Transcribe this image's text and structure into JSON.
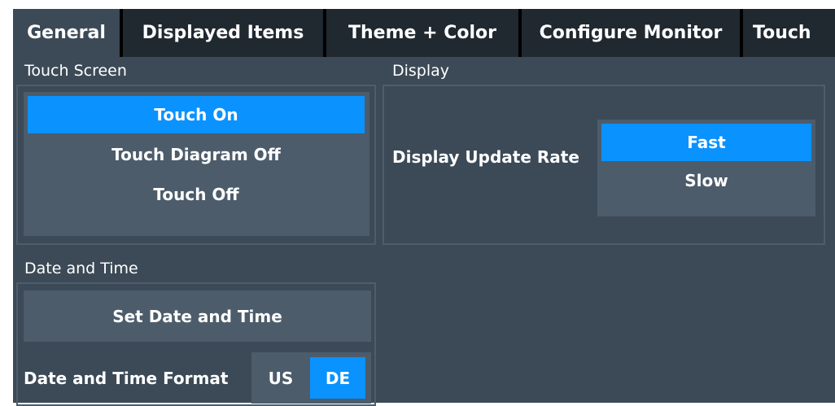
{
  "tabs": [
    {
      "label": "General",
      "active": true
    },
    {
      "label": "Displayed Items",
      "active": false
    },
    {
      "label": "Theme + Color",
      "active": false
    },
    {
      "label": "Configure Monitor",
      "active": false
    },
    {
      "label": "Touch",
      "active": false
    }
  ],
  "touch_screen": {
    "title": "Touch Screen",
    "options": [
      "Touch On",
      "Touch Diagram Off",
      "Touch Off"
    ],
    "selected": "Touch On"
  },
  "display": {
    "title": "Display",
    "update_rate_label": "Display Update Rate",
    "options": [
      "Fast",
      "Slow"
    ],
    "selected": "Fast"
  },
  "date_time": {
    "title": "Date and Time",
    "set_button": "Set Date and Time",
    "format_label": "Date and Time Format",
    "format_options": [
      "US",
      "DE"
    ],
    "format_selected": "DE"
  },
  "colors": {
    "selected_accent": "#0a92ff",
    "panel_bg": "#3c4a57",
    "option_bg": "#4c5c6b",
    "tab_bg": "#202830"
  }
}
